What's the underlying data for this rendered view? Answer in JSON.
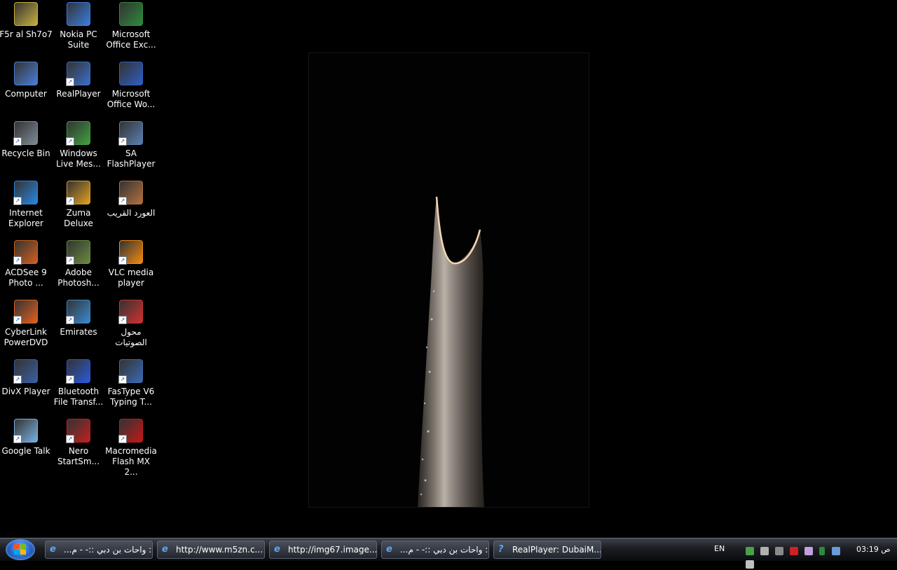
{
  "desktop": {
    "icons": [
      {
        "label": "F5r al Sh7o7",
        "color": "#c8b040",
        "glyph": "folder-icon"
      },
      {
        "label": "Nokia PC Suite",
        "color": "#3a7de0",
        "glyph": "nokia-icon"
      },
      {
        "label": "Microsoft Office Exc...",
        "color": "#2e8b3a",
        "glyph": "excel-icon"
      },
      {
        "label": "Computer",
        "color": "#4a7fd6",
        "glyph": "computer-icon"
      },
      {
        "label": "RealPlayer",
        "color": "#3a6fc6",
        "glyph": "realplayer-icon"
      },
      {
        "label": "Microsoft Office Wo...",
        "color": "#2f5fc0",
        "glyph": "word-icon"
      },
      {
        "label": "Recycle Bin",
        "color": "#7e8a96",
        "glyph": "recycle-bin-icon"
      },
      {
        "label": "Windows Live Mes...",
        "color": "#3fa040",
        "glyph": "messenger-icon"
      },
      {
        "label": "SA FlashPlayer",
        "color": "#5a7fb0",
        "glyph": "flash-icon"
      },
      {
        "label": "Internet Explorer",
        "color": "#2a86e0",
        "glyph": "ie-icon"
      },
      {
        "label": "Zuma Deluxe",
        "color": "#e0a020",
        "glyph": "zuma-icon"
      },
      {
        "label": "العورد القريب",
        "color": "#b07040",
        "glyph": "dictionary-icon"
      },
      {
        "label": "ACDSee 9 Photo ...",
        "color": "#d06020",
        "glyph": "acdsee-icon"
      },
      {
        "label": "Adobe Photosh...",
        "color": "#6a8a40",
        "glyph": "photoshop-icon"
      },
      {
        "label": "VLC media player",
        "color": "#f08a10",
        "glyph": "vlc-icon"
      },
      {
        "label": "CyberLink PowerDVD",
        "color": "#e06020",
        "glyph": "powerdvd-icon"
      },
      {
        "label": "Emirates",
        "color": "#3a8ad0",
        "glyph": "globe-icon"
      },
      {
        "label": "محول الصوتيات",
        "color": "#d03030",
        "glyph": "converter-icon"
      },
      {
        "label": "DivX Player",
        "color": "#3a5fa0",
        "glyph": "divx-icon"
      },
      {
        "label": "Bluetooth File Transf...",
        "color": "#2a5ad8",
        "glyph": "bluetooth-icon"
      },
      {
        "label": "FasType V6 Typing T...",
        "color": "#3a6ab0",
        "glyph": "keyboard-icon"
      },
      {
        "label": "Google Talk",
        "color": "#7ab0e0",
        "glyph": "gtalk-icon"
      },
      {
        "label": "Nero StartSm...",
        "color": "#c02020",
        "glyph": "nero-icon"
      },
      {
        "label": "Macromedia Flash MX 2...",
        "color": "#c01818",
        "glyph": "flash-mx-icon"
      }
    ]
  },
  "taskbar": {
    "buttons": [
      {
        "label": "...واحات بن دبي ::- - م ::"
      },
      {
        "label": "http://www.m5zn.c..."
      },
      {
        "label": "http://img67.image..."
      },
      {
        "label": "...واحات بن دبي ::- - م ::"
      },
      {
        "label": "RealPlayer: DubaiM..."
      }
    ],
    "language": "EN",
    "clock": "03:19 ص"
  }
}
